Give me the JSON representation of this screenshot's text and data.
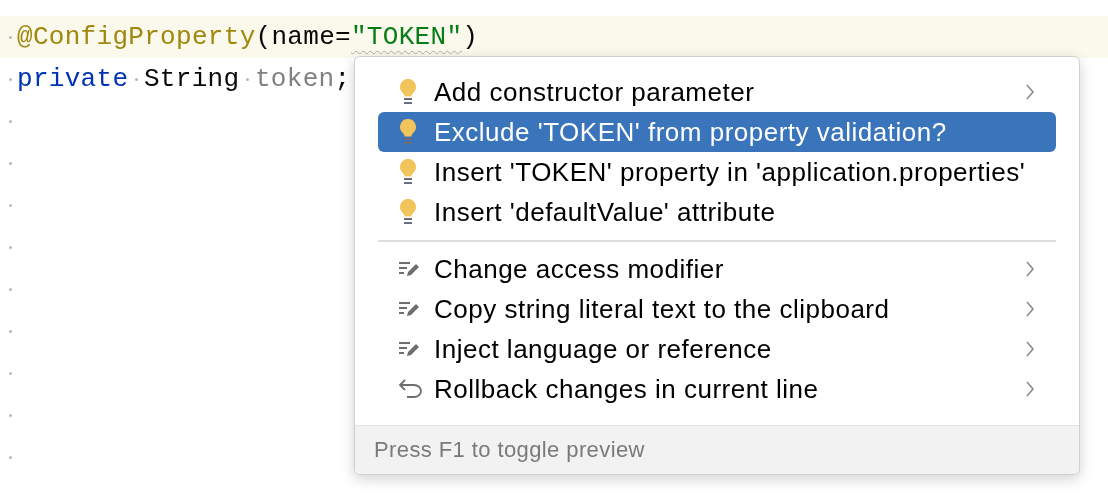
{
  "editor": {
    "lines": [
      {
        "current": true,
        "tokens": [
          {
            "kind": "annotation",
            "text": "@ConfigProperty"
          },
          {
            "kind": "punct",
            "text": "(name="
          },
          {
            "kind": "string",
            "text": "\"TOKEN\"",
            "warning": true
          },
          {
            "kind": "punct",
            "text": ")"
          }
        ]
      },
      {
        "current": false,
        "tokens": [
          {
            "kind": "keyword",
            "text": "private"
          },
          {
            "kind": "space"
          },
          {
            "kind": "type",
            "text": "String"
          },
          {
            "kind": "space"
          },
          {
            "kind": "field",
            "text": "token"
          },
          {
            "kind": "punct",
            "text": ";"
          }
        ]
      },
      {
        "current": false
      },
      {
        "current": false
      },
      {
        "current": false
      },
      {
        "current": false
      },
      {
        "current": false
      },
      {
        "current": false
      },
      {
        "current": false
      },
      {
        "current": false
      },
      {
        "current": false
      }
    ]
  },
  "popup": {
    "sections": [
      {
        "items": [
          {
            "kind": "bulb",
            "label": "Add constructor parameter",
            "submenu": true,
            "selected": false
          },
          {
            "kind": "bulb",
            "label": "Exclude 'TOKEN' from property validation?",
            "submenu": false,
            "selected": true
          },
          {
            "kind": "bulb",
            "label": "Insert 'TOKEN' property in 'application.properties'",
            "submenu": false,
            "selected": false
          },
          {
            "kind": "bulb",
            "label": "Insert 'defaultValue' attribute",
            "submenu": false,
            "selected": false
          }
        ]
      },
      {
        "items": [
          {
            "kind": "edit",
            "label": "Change access modifier",
            "submenu": true,
            "selected": false
          },
          {
            "kind": "edit",
            "label": "Copy string literal text to the clipboard",
            "submenu": true,
            "selected": false
          },
          {
            "kind": "edit",
            "label": "Inject language or reference",
            "submenu": true,
            "selected": false
          },
          {
            "kind": "undo",
            "label": "Rollback changes in current line",
            "submenu": true,
            "selected": false
          }
        ]
      }
    ],
    "footer": "Press F1 to toggle preview"
  }
}
